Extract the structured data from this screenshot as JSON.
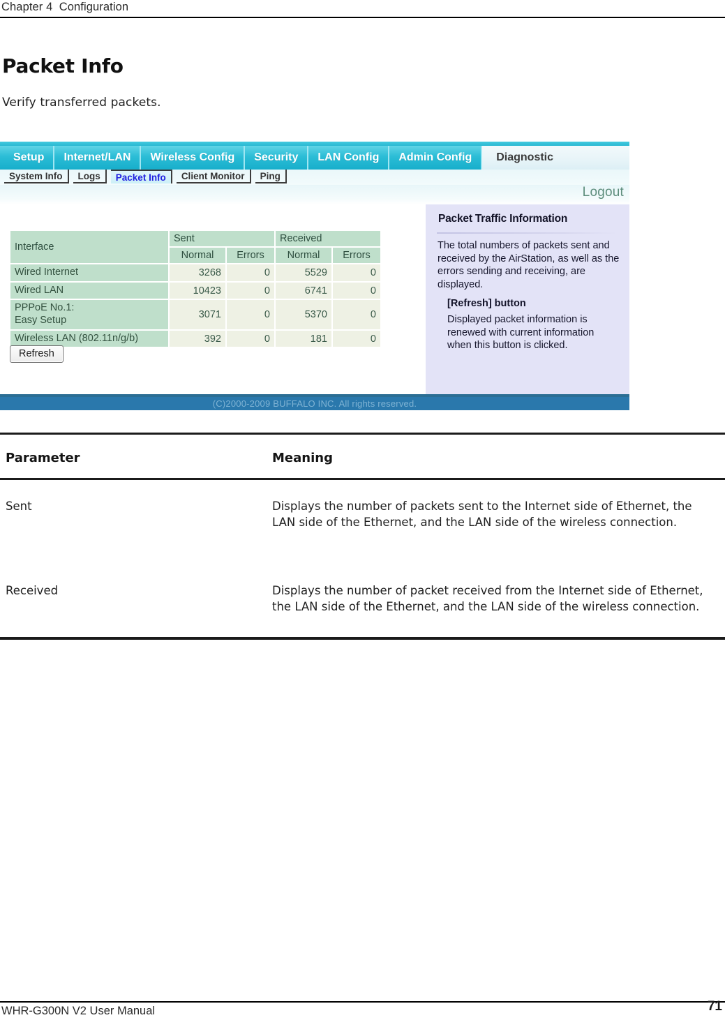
{
  "page": {
    "running_head": "Chapter 4  Configuration",
    "section_title": "Packet Info",
    "section_subtitle": "Verify transferred packets.",
    "footer_left": "WHR-G300N V2 User Manual",
    "footer_page_number": "71"
  },
  "router_ui": {
    "main_tabs": [
      {
        "label": "Setup",
        "active": false
      },
      {
        "label": "Internet/LAN",
        "active": false
      },
      {
        "label": "Wireless Config",
        "active": false
      },
      {
        "label": "Security",
        "active": false
      },
      {
        "label": "LAN Config",
        "active": false
      },
      {
        "label": "Admin Config",
        "active": false
      },
      {
        "label": "Diagnostic",
        "active": true
      }
    ],
    "sub_tabs": [
      {
        "label": "System Info",
        "active": false
      },
      {
        "label": "Logs",
        "active": false
      },
      {
        "label": "Packet Info",
        "active": true
      },
      {
        "label": "Client Monitor",
        "active": false
      },
      {
        "label": "Ping",
        "active": false
      }
    ],
    "logout_label": "Logout",
    "packet_table": {
      "interface_header": "Interface",
      "group_headers": [
        "Sent",
        "Received"
      ],
      "sub_headers": [
        "Normal",
        "Errors",
        "Normal",
        "Errors"
      ],
      "rows": [
        {
          "interface": "Wired Internet",
          "sent_normal": "3268",
          "sent_errors": "0",
          "recv_normal": "5529",
          "recv_errors": "0"
        },
        {
          "interface": "Wired LAN",
          "sent_normal": "10423",
          "sent_errors": "0",
          "recv_normal": "6741",
          "recv_errors": "0"
        },
        {
          "interface": "PPPoE No.1:\nEasy Setup",
          "sent_normal": "3071",
          "sent_errors": "0",
          "recv_normal": "5370",
          "recv_errors": "0"
        },
        {
          "interface": "Wireless LAN (802.11n/g/b)",
          "sent_normal": "392",
          "sent_errors": "0",
          "recv_normal": "181",
          "recv_errors": "0"
        }
      ]
    },
    "refresh_button": "Refresh",
    "help": {
      "title": "Packet Traffic Information",
      "body": "The total numbers of packets sent and received by the AirStation, as well as the errors sending and receiving, are displayed.",
      "sub_title": "[Refresh] button",
      "sub_body": "Displayed packet information is renewed with current information when this button is clicked."
    },
    "copyright": "(C)2000-2009 BUFFALO INC. All rights reserved.",
    "colors": {
      "nav_cyan": "#2bbdd6",
      "table_header_green": "#bfdfcb",
      "table_cell_cream": "#eef1e4",
      "help_panel_lavender": "#e3e3f7",
      "footer_blue": "#2a78ac",
      "active_subtab_text": "#2121e0"
    }
  },
  "param_table": {
    "headers": [
      "Parameter",
      "Meaning"
    ],
    "rows": [
      {
        "parameter": "Sent",
        "meaning": "Displays the number of packets sent to the Internet side of Ethernet, the LAN side of the Ethernet, and the LAN side of the wireless connection."
      },
      {
        "parameter": "Received",
        "meaning": "Displays the number of packet received from the Internet side of Ethernet, the LAN side of the Ethernet, and the LAN side of the wireless connection."
      }
    ]
  }
}
